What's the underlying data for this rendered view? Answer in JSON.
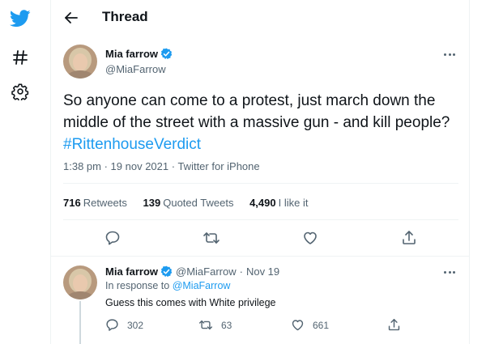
{
  "nav": {
    "items": [
      {
        "icon": "twitter-logo-icon"
      },
      {
        "icon": "hashtag-icon"
      },
      {
        "icon": "gear-icon"
      }
    ]
  },
  "header": {
    "title": "Thread"
  },
  "tweet": {
    "display_name": "Mia farrow",
    "handle": "@MiaFarrow",
    "text_before": "So anyone can come to a protest, just march down the middle of the street with a massive gun - and kill people?",
    "hashtag": "#RittenhouseVerdict",
    "time": "1:38 pm",
    "date": "19 nov 2021",
    "client": "Twitter for iPhone",
    "retweets_count": "716",
    "retweets_label": "Retweets",
    "quotes_count": "139",
    "quotes_label": "Quoted Tweets",
    "likes_count": "4,490",
    "likes_label": "I like it"
  },
  "reply": {
    "display_name": "Mia farrow",
    "handle": "@MiaFarrow",
    "date": "Nov 19",
    "in_response_label": "In response to",
    "in_response_handle": "@MiaFarrow",
    "text": "Guess this comes with White privilege",
    "replies": "302",
    "retweets": "63",
    "likes": "661"
  },
  "colors": {
    "accent": "#1d9bf0",
    "text": "#0f1419",
    "secondary": "#536471"
  }
}
